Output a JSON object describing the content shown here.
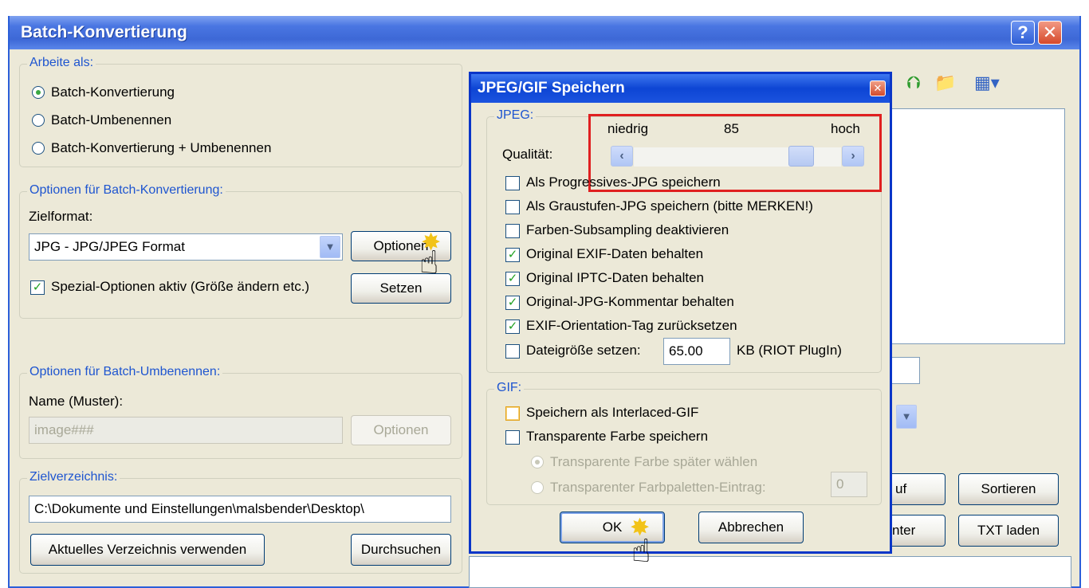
{
  "main": {
    "title": "Batch-Konvertierung",
    "help_button": "?",
    "close_button": "✕"
  },
  "arbeite_als": {
    "title": "Arbeite als:",
    "options": [
      {
        "label": "Batch-Konvertierung",
        "selected": true
      },
      {
        "label": "Batch-Umbenennen",
        "selected": false
      },
      {
        "label": "Batch-Konvertierung + Umbenennen",
        "selected": false
      }
    ]
  },
  "batch_konvertierung": {
    "title": "Optionen für Batch-Konvertierung:",
    "zielformat_label": "Zielformat:",
    "zielformat_value": "JPG - JPG/JPEG Format",
    "optionen_button": "Optionen",
    "special_checkbox_label": "Spezial-Optionen aktiv (Größe ändern etc.)",
    "setzen_button": "Setzen"
  },
  "batch_umbenennen": {
    "title": "Optionen für Batch-Umbenennen:",
    "name_label": "Name (Muster):",
    "name_value": "image###",
    "optionen_button": "Optionen"
  },
  "zielverzeichnis": {
    "title": "Zielverzeichnis:",
    "path": "C:\\Dokumente und Einstellungen\\malsbender\\Desktop\\",
    "aktuelles_button": "Aktuelles Verzeichnis verwenden",
    "durchsuchen_button": "Durchsuchen"
  },
  "right_panel": {
    "button_auf_partial": "uf",
    "button_sortieren": "Sortieren",
    "button_unter_partial": "nter",
    "button_txt_laden": "TXT laden"
  },
  "dialog": {
    "title": "JPEG/GIF Speichern",
    "close_button": "✕",
    "jpeg_group_title": "JPEG:",
    "quality_label": "Qualität:",
    "quality_low": "niedrig",
    "quality_value": "85",
    "quality_high": "hoch",
    "quality_slider_fraction": 0.85,
    "checkboxes": [
      {
        "label": "Als Progressives-JPG speichern",
        "checked": false
      },
      {
        "label": "Als Graustufen-JPG speichern (bitte MERKEN!)",
        "checked": false
      },
      {
        "label": "Farben-Subsampling deaktivieren",
        "checked": false
      },
      {
        "label": "Original EXIF-Daten behalten",
        "checked": true
      },
      {
        "label": "Original IPTC-Daten behalten",
        "checked": true
      },
      {
        "label": "Original-JPG-Kommentar behalten",
        "checked": true
      },
      {
        "label": "EXIF-Orientation-Tag zurücksetzen",
        "checked": true
      }
    ],
    "dateigroesse_label": "Dateigröße setzen:",
    "dateigroesse_value": "65.00",
    "dateigroesse_unit": "KB (RIOT PlugIn)",
    "gif_group_title": "GIF:",
    "gif_interlaced_label": "Speichern als Interlaced-GIF",
    "gif_transparent_label": "Transparente Farbe speichern",
    "gif_radio_later": "Transparente Farbe später wählen",
    "gif_radio_palette": "Transparenter Farbpaletten-Eintrag:",
    "gif_palette_value": "0",
    "ok_button": "OK",
    "cancel_button": "Abbrechen"
  }
}
